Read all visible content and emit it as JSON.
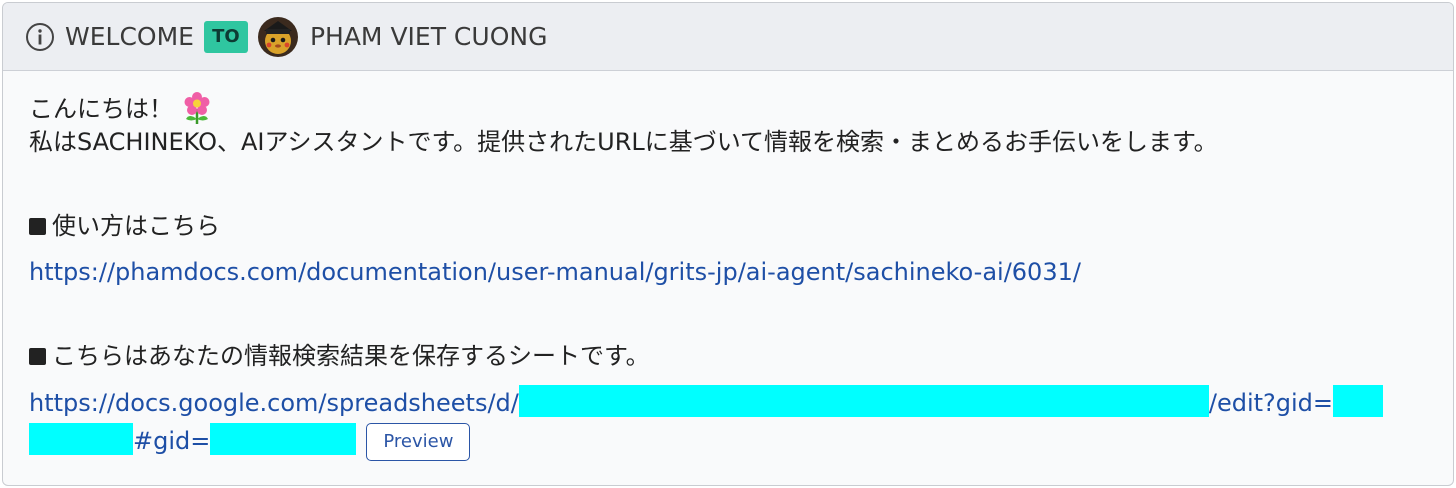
{
  "header": {
    "welcome": "WELCOME",
    "badge": "TO",
    "user_name": "PHAM VIET CUONG",
    "info_icon": "info-circle-icon",
    "avatar_icon": "avatar-pikachu-icon"
  },
  "message": {
    "greeting": "こんにちは！",
    "greeting_emoji": "flower-icon",
    "intro": "私はSACHINEKO、AIアシスタントです。提供されたURLに基づいて情報を検索・まとめるお手伝いをします。",
    "usage_heading": "使い方はこちら",
    "usage_link": "https://phamdocs.com/documentation/user-manual/grits-jp/ai-agent/sachineko-ai/6031/",
    "sheet_heading": "こちらはあなたの情報検索結果を保存するシートです。",
    "sheet_link_prefix": "https://docs.google.com/spreadsheets/d/",
    "sheet_link_mid": "/edit?gid=",
    "sheet_link_suffix": "#gid=",
    "preview_label": "Preview"
  },
  "colors": {
    "badge": "#2fc6a0",
    "link": "#1e4fa6",
    "redaction": "#00ffff",
    "header_bg": "#eceef2"
  }
}
